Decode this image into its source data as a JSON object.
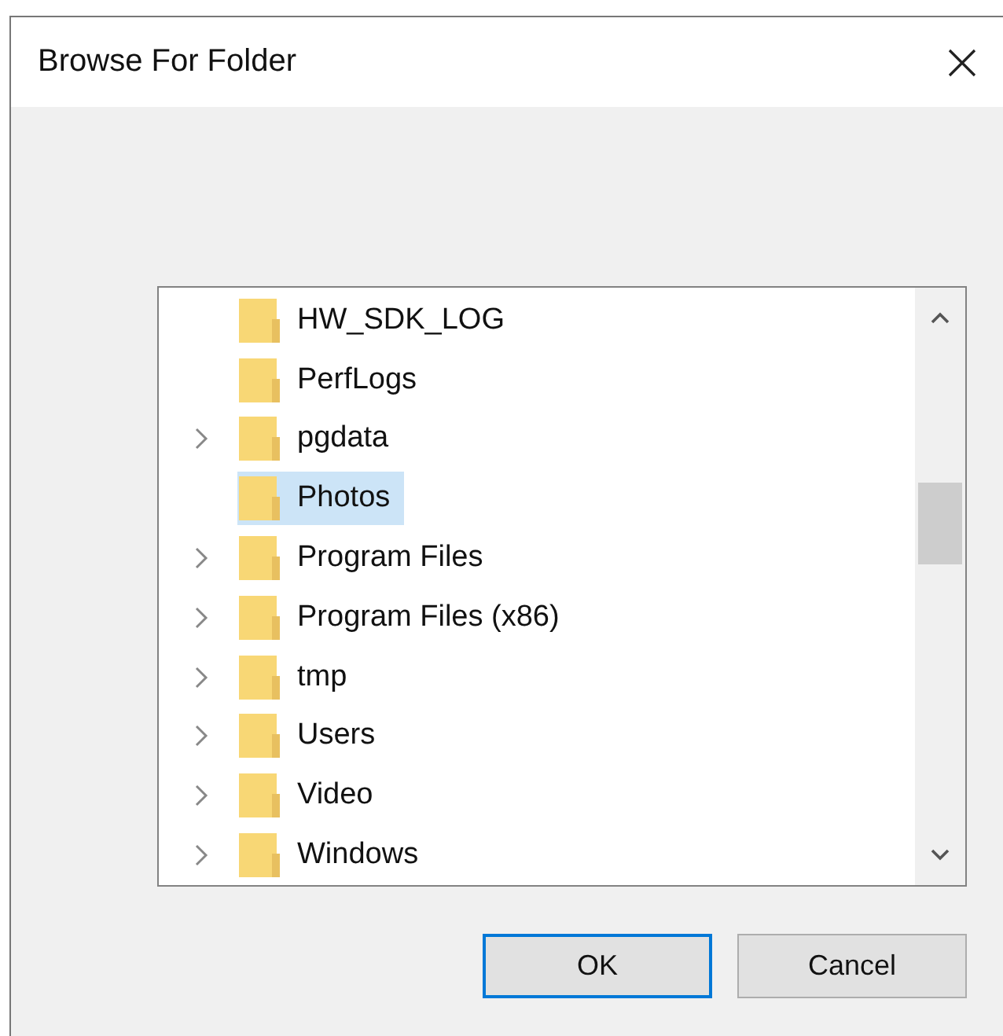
{
  "window": {
    "title": "Browse For Folder"
  },
  "tree": {
    "items": [
      {
        "name": "HW_SDK_LOG",
        "expandable": false,
        "selected": false
      },
      {
        "name": "PerfLogs",
        "expandable": false,
        "selected": false
      },
      {
        "name": "pgdata",
        "expandable": true,
        "selected": false
      },
      {
        "name": "Photos",
        "expandable": false,
        "selected": true
      },
      {
        "name": "Program Files",
        "expandable": true,
        "selected": false
      },
      {
        "name": "Program Files (x86)",
        "expandable": true,
        "selected": false
      },
      {
        "name": "tmp",
        "expandable": true,
        "selected": false
      },
      {
        "name": "Users",
        "expandable": true,
        "selected": false
      },
      {
        "name": "Video",
        "expandable": true,
        "selected": false
      },
      {
        "name": "Windows",
        "expandable": true,
        "selected": false
      }
    ]
  },
  "buttons": [
    {
      "label": "OK",
      "default": true
    },
    {
      "label": "Cancel",
      "default": false
    }
  ]
}
